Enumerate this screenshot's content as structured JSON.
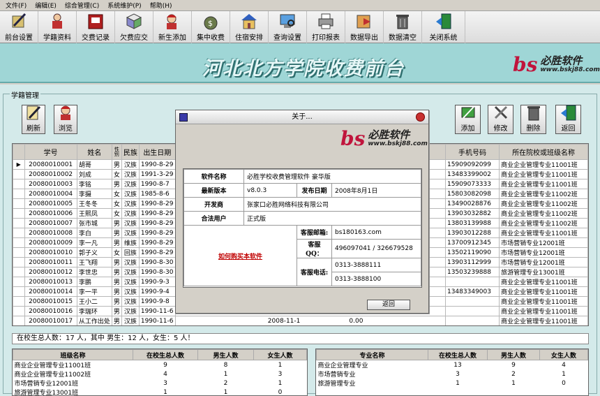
{
  "menu": [
    "文件(F)",
    "编辑(E)",
    "综合管理(C)",
    "系统维护(P)",
    "帮助(H)"
  ],
  "toolbar": [
    {
      "label": "前台设置",
      "icon": "pen-icon"
    },
    {
      "label": "学籍资料",
      "icon": "student-icon"
    },
    {
      "label": "交费记录",
      "icon": "cash-register-icon"
    },
    {
      "label": "欠费应交",
      "icon": "book-icon"
    },
    {
      "label": "新生添加",
      "icon": "new-student-icon"
    },
    {
      "label": "集中收费",
      "icon": "money-bag-icon"
    },
    {
      "label": "住宿安排",
      "icon": "house-icon"
    },
    {
      "label": "查询设置",
      "icon": "search-computer-icon"
    },
    {
      "label": "打印报表",
      "icon": "printer-icon"
    },
    {
      "label": "数据导出",
      "icon": "export-icon"
    },
    {
      "label": "数据清空",
      "icon": "trash-icon"
    },
    {
      "label": "关闭系统",
      "icon": "exit-icon"
    }
  ],
  "banner": {
    "title": "河北北方学院收费前台",
    "brand_name": "必胜软件",
    "brand_url": "www.bskj88.com"
  },
  "panel": {
    "title": "学籍管理"
  },
  "actions": {
    "refresh": "刷新",
    "browse": "浏览",
    "add": "添加",
    "edit": "修改",
    "delete": "删除",
    "back": "返回"
  },
  "grid": {
    "columns": [
      "学号",
      "姓名",
      "性别",
      "民族",
      "出生日期",
      "手机号码",
      "所在院校或班级名称"
    ],
    "rows": [
      {
        "id": "20080010001",
        "name": "胡哥",
        "gender": "男",
        "nation": "汉族",
        "birth": "1990-8-29",
        "phone": "15909092099",
        "class": "商业企业管理专业11001班"
      },
      {
        "id": "20080010002",
        "name": "刘成",
        "gender": "女",
        "nation": "汉族",
        "birth": "1991-3-29",
        "phone": "13483399002",
        "class": "商业企业管理专业11001班"
      },
      {
        "id": "20080010003",
        "name": "李铭",
        "gender": "男",
        "nation": "汉族",
        "birth": "1990-8-7",
        "phone": "15909073333",
        "class": "商业企业管理专业11001班"
      },
      {
        "id": "20080010004",
        "name": "李摄",
        "gender": "女",
        "nation": "汉族",
        "birth": "1985-8-6",
        "phone": "15803082098",
        "class": "商业企业管理专业11002班"
      },
      {
        "id": "20080010005",
        "name": "王冬冬",
        "gender": "女",
        "nation": "汉族",
        "birth": "1990-8-29",
        "phone": "13490028876",
        "class": "商业企业管理专业11002班"
      },
      {
        "id": "20080010006",
        "name": "王熙凤",
        "gender": "女",
        "nation": "汉族",
        "birth": "1990-8-29",
        "phone": "13903032882",
        "class": "商业企业管理专业11002班"
      },
      {
        "id": "20080010007",
        "name": "张市城",
        "gender": "男",
        "nation": "汉族",
        "birth": "1990-8-29",
        "phone": "13803139988",
        "class": "商业企业管理专业11002班"
      },
      {
        "id": "20080010008",
        "name": "李白",
        "gender": "男",
        "nation": "汉族",
        "birth": "1990-8-29",
        "phone": "13903012288",
        "class": "商业企业管理专业11001班"
      },
      {
        "id": "20080010009",
        "name": "李一凡",
        "gender": "男",
        "nation": "维族",
        "birth": "1990-8-29",
        "phone": "13700912345",
        "class": "市场营销专业12001班"
      },
      {
        "id": "20080010010",
        "name": "郭子义",
        "gender": "女",
        "nation": "回族",
        "birth": "1990-8-29",
        "phone": "13502119090",
        "class": "市场营销专业12001班"
      },
      {
        "id": "20080010011",
        "name": "王飞翔",
        "gender": "男",
        "nation": "汉族",
        "birth": "1990-8-30",
        "phone": "13903112999",
        "class": "市场营销专业12001班"
      },
      {
        "id": "20080010012",
        "name": "李世忠",
        "gender": "男",
        "nation": "汉族",
        "birth": "1990-8-30",
        "phone": "13503239888",
        "class": "旅游管理专业13001班"
      },
      {
        "id": "20080010013",
        "name": "李鹏",
        "gender": "男",
        "nation": "汉族",
        "birth": "1990-9-3",
        "phone": "",
        "class": "商业企业管理专业11001班"
      },
      {
        "id": "20080010014",
        "name": "李一平",
        "gender": "男",
        "nation": "汉族",
        "birth": "1990-9-4",
        "phone": "13483349003",
        "class": "商业企业管理专业11001班"
      },
      {
        "id": "20080010015",
        "name": "王小二",
        "gender": "男",
        "nation": "汉族",
        "birth": "1990-9-8",
        "phone": "",
        "class": "商业企业管理专业11001班"
      },
      {
        "id": "20080010016",
        "name": "李瑞环",
        "gender": "男",
        "nation": "汉族",
        "birth": "1990-11-6",
        "phone": "",
        "class": "商业企业管理专业11001班"
      },
      {
        "id": "20080010017",
        "name": "从工作出处",
        "gender": "男",
        "nation": "汉族",
        "birth": "1990-11-6",
        "phone": "",
        "class": "商业企业管理专业11001班"
      }
    ],
    "partial_date": "2008-11-1",
    "partial_amount": "0.00"
  },
  "summary": "在校生总人数：17 人，其中 男生：12 人，女生：5 人！",
  "class_stats": {
    "columns": [
      "班级名称",
      "在校生总人数",
      "男生人数",
      "女生人数"
    ],
    "rows": [
      [
        "商业企业管理专业11001班",
        "9",
        "8",
        "1"
      ],
      [
        "商业企业管理专业11002班",
        "4",
        "1",
        "3"
      ],
      [
        "市场营销专业12001班",
        "3",
        "2",
        "1"
      ],
      [
        "旅游管理专业13001班",
        "1",
        "1",
        "0"
      ]
    ]
  },
  "major_stats": {
    "columns": [
      "专业名称",
      "在校生总人数",
      "男生人数",
      "女生人数"
    ],
    "rows": [
      [
        "商业企业管理专业",
        "13",
        "9",
        "4"
      ],
      [
        "市场营销专业",
        "3",
        "2",
        "1"
      ],
      [
        "旅游管理专业",
        "1",
        "1",
        "0"
      ]
    ]
  },
  "about": {
    "title": "关于...",
    "labels": {
      "software": "软件名称",
      "version": "最新版本",
      "release": "发布日期",
      "developer": "开发商",
      "user": "合法用户",
      "email": "客服邮箱:",
      "qq": "客服QQ：",
      "phone": "客服电话:"
    },
    "software": "必胜学校收费管理软件 豪华版",
    "version": "v8.0.3",
    "release": "2008年8月1日",
    "developer": "张家口必胜网络科技有限公司",
    "user": "正式版",
    "buy": "如何购买本软件",
    "email": "bs180163.com",
    "qq": "496097041 / 326679528",
    "phone1": "0313-3888111",
    "phone2": "0313-3888100",
    "back": "返回"
  },
  "colors": {
    "banner": "#9fd6d6",
    "main": "#d4eaea",
    "brand_red": "#c0143c"
  }
}
